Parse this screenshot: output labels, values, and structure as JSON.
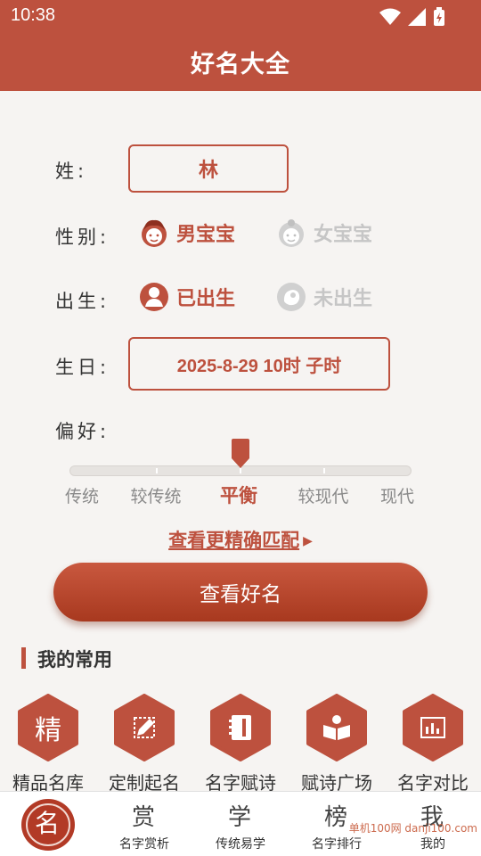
{
  "status": {
    "time": "10:38"
  },
  "header": {
    "title": "好名大全"
  },
  "form": {
    "surname_label": "姓:",
    "surname_value": "林",
    "gender_label": "性别:",
    "gender_options": [
      "男宝宝",
      "女宝宝"
    ],
    "gender_selected": "男宝宝",
    "birth_label": "出生:",
    "birth_options": [
      "已出生",
      "未出生"
    ],
    "birth_selected": "已出生",
    "birthday_label": "生日:",
    "birthday_value": "2025-8-29 10时 子时",
    "pref_label": "偏好:",
    "pref_options": [
      "传统",
      "较传统",
      "平衡",
      "较现代",
      "现代"
    ],
    "pref_selected": "平衡",
    "pref_position": 0.5
  },
  "more_link": "查看更精确匹配",
  "cta_label": "查看好名",
  "section": {
    "title": "我的常用"
  },
  "tools": [
    {
      "label": "精品名库",
      "icon": "char-jing-icon",
      "glyph": "精"
    },
    {
      "label": "定制起名",
      "icon": "pencil-icon",
      "glyph": ""
    },
    {
      "label": "名字赋诗",
      "icon": "notebook-icon",
      "glyph": ""
    },
    {
      "label": "赋诗广场",
      "icon": "book-reader-icon",
      "glyph": ""
    },
    {
      "label": "名字对比",
      "icon": "bar-chart-icon",
      "glyph": ""
    }
  ],
  "nav": [
    {
      "label": "",
      "seal": "名",
      "icon": "home-seal-icon"
    },
    {
      "label": "名字赏析",
      "seal": "赏",
      "icon": "seal-shang-icon"
    },
    {
      "label": "传统易学",
      "seal": "学",
      "icon": "seal-xue-icon"
    },
    {
      "label": "名字排行",
      "seal": "榜",
      "icon": "seal-bang-icon"
    },
    {
      "label": "我的",
      "seal": "我",
      "icon": "seal-wo-icon"
    }
  ],
  "watermark": "单机100网 danji100.com",
  "colors": {
    "accent": "#bd513e",
    "header": "#bd513e",
    "background": "#f6f4f2"
  }
}
